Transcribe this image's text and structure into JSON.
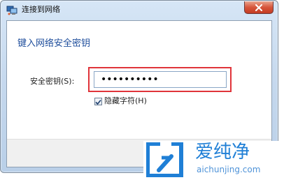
{
  "window": {
    "title": "连接到网络",
    "close_label": "x"
  },
  "dialog": {
    "heading": "键入网络安全密钥",
    "security_key_label": "安全密钥(S):",
    "security_key_value": "••••••••••",
    "hide_characters_label": "隐藏字符(H)",
    "hide_characters_checked": true
  },
  "watermark": {
    "brand": "爱纯净",
    "url": "aichunjing.com"
  },
  "colors": {
    "highlight": "#e0343a",
    "heading": "#1f4e9c",
    "watermark": "#1f7fd6"
  },
  "icons": {
    "app": "network-icon",
    "close": "close-icon",
    "check": "checkmark-icon",
    "watermark": "aichunjing-logo-icon"
  }
}
